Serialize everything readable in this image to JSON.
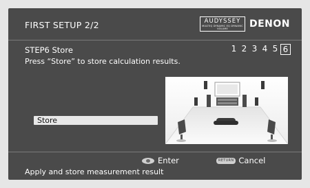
{
  "header": {
    "title": "FIRST SETUP 2/2",
    "logo_main": "AUDYSSEY",
    "logo_sub": "MULTEQ DYNAMIC EQ DYNAMIC VOLUME",
    "brand": "DENON"
  },
  "step": {
    "title": "STEP6 Store",
    "instruction": "Press “Store” to store calculation results.",
    "indicators": [
      "1",
      "2",
      "3",
      "4",
      "5",
      "6"
    ],
    "current": "6"
  },
  "actions": {
    "store_label": "Store"
  },
  "footer": {
    "enter_label": "Enter",
    "return_badge": "RETURN",
    "cancel_label": "Cancel",
    "help_text": "Apply and store measurement result"
  },
  "colors": {
    "panel": "#4a4a4a",
    "highlight": "#e8e8e8",
    "text": "#ffffff"
  },
  "icons": [
    "enter-button-icon",
    "return-button-icon",
    "speaker-room-illustration"
  ]
}
